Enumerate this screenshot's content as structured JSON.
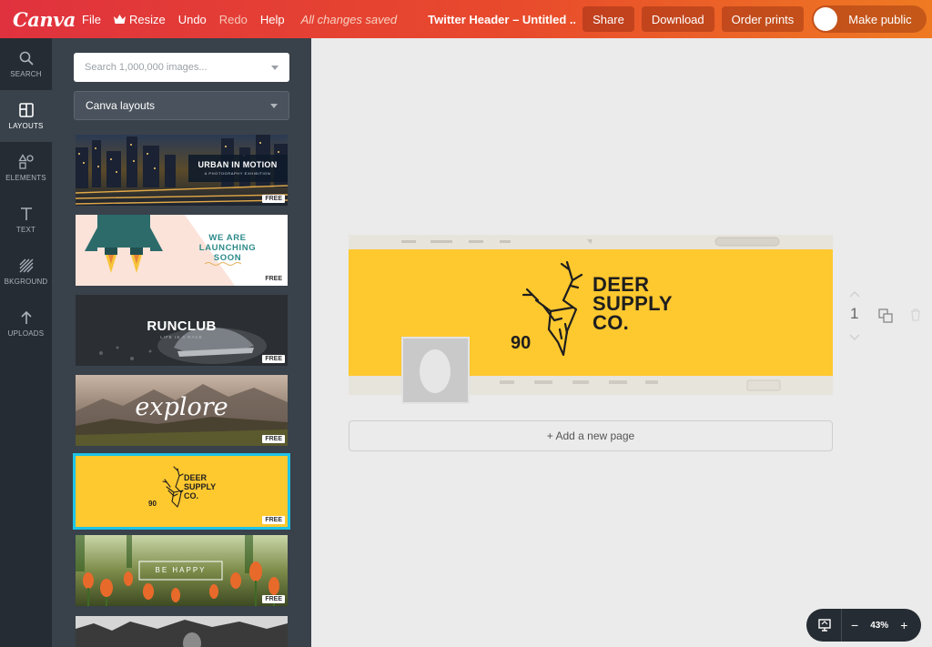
{
  "topbar": {
    "logo": "Canva",
    "file": "File",
    "resize": "Resize",
    "undo": "Undo",
    "redo": "Redo",
    "help": "Help",
    "saved": "All changes saved",
    "doc_title": "Twitter Header – Untitled ...",
    "share": "Share",
    "download": "Download",
    "order_prints": "Order prints",
    "make_public": "Make public"
  },
  "rail": [
    {
      "label": "SEARCH",
      "icon": "search-icon"
    },
    {
      "label": "LAYOUTS",
      "icon": "layouts-icon"
    },
    {
      "label": "ELEMENTS",
      "icon": "elements-icon"
    },
    {
      "label": "TEXT",
      "icon": "text-icon"
    },
    {
      "label": "BKGROUND",
      "icon": "background-icon"
    },
    {
      "label": "UPLOADS",
      "icon": "upload-icon"
    }
  ],
  "panel": {
    "search_placeholder": "Search 1,000,000 images...",
    "layout_select": "Canva layouts",
    "badge": "FREE",
    "thumbs": [
      {
        "title": "URBAN IN MOTION",
        "subtitle": "A PHOTOGRAPHY EXHIBITION"
      },
      {
        "title_line1": "WE ARE",
        "title_line2": "LAUNCHING",
        "title_line3": "SOON"
      },
      {
        "title": "RUNCLUB",
        "subtitle": "LIFE IS A RACE"
      },
      {
        "title": "explore"
      },
      {
        "line1": "DEER",
        "line2": "SUPPLY",
        "line3": "CO.",
        "number": "90"
      },
      {
        "title": "BE HAPPY"
      }
    ]
  },
  "design": {
    "line1": "DEER",
    "line2": "SUPPLY",
    "line3": "CO.",
    "number": "90",
    "add_page": "+ Add a new page",
    "page_number": "1"
  },
  "zoom": {
    "value": "43%",
    "minus": "−",
    "plus": "+"
  },
  "colors": {
    "accent": "#e84a2c",
    "brand_yellow": "#fec82f",
    "selection": "#1fc3e6"
  }
}
